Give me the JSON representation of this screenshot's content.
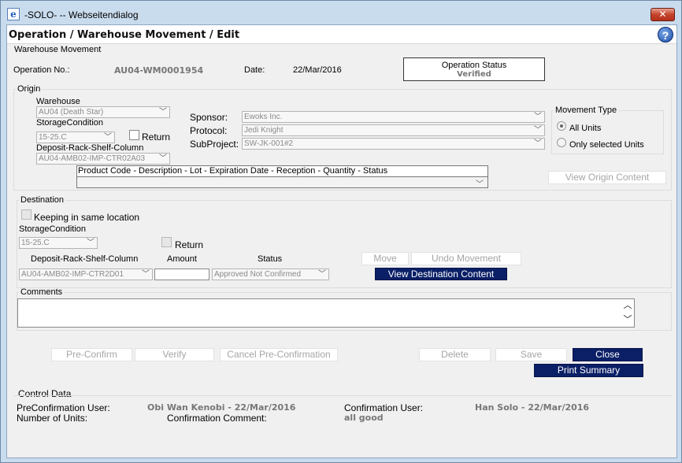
{
  "window": {
    "title": "-SOLO- -- Webseitendialog",
    "app_icon": "e",
    "close_symbol": "✕"
  },
  "header": {
    "title": "Operation / Warehouse Movement / Edit",
    "help_symbol": "?"
  },
  "section_title": "Warehouse Movement",
  "operation": {
    "no_label": "Operation No.:",
    "no_value": "AU04-WM0001954",
    "date_label": "Date:",
    "date_value": "22/Mar/2016",
    "status_label": "Operation Status",
    "status_value": "Verified"
  },
  "origin": {
    "legend": "Origin",
    "warehouse_label": "Warehouse",
    "warehouse_value": "AU04 (Death Star)",
    "storage_label": "StorageCondition",
    "storage_value": "15-25.C",
    "return_label": "Return",
    "deposit_label": "Deposit-Rack-Shelf-Column",
    "deposit_value": "AU04-AMB02-IMP-CTR02A03",
    "sponsor_label": "Sponsor:",
    "sponsor_value": "Ewoks Inc.",
    "protocol_label": "Protocol:",
    "protocol_value": "Jedi Knight",
    "subproject_label": "SubProject:",
    "subproject_value": "SW-JK-001#2",
    "movement_type_legend": "Movement Type",
    "all_units_label": "All Units",
    "selected_units_label": "Only selected Units",
    "product_header": "Product Code - Description - Lot - Expiration Date - Reception - Quantity - Status",
    "view_origin_label": "View Origin Content"
  },
  "destination": {
    "legend": "Destination",
    "keeping_label": "Keeping in same location",
    "storage_label": "StorageCondition",
    "storage_value": "15-25.C",
    "return_label": "Return",
    "deposit_label": "Deposit-Rack-Shelf-Column",
    "deposit_value": "AU04-AMB02-IMP-CTR2D01",
    "amount_label": "Amount",
    "amount_value": "",
    "status_label": "Status",
    "status_value": "Approved Not Confirmed",
    "move_label": "Move",
    "undo_label": "Undo Movement",
    "view_dest_label": "View Destination Content"
  },
  "comments": {
    "legend": "Comments",
    "value": ""
  },
  "actions": {
    "pre_confirm": "Pre-Confirm",
    "verify": "Verify",
    "cancel_pre": "Cancel Pre-Confirmation",
    "delete": "Delete",
    "save": "Save",
    "close": "Close",
    "print_summary": "Print Summary"
  },
  "control": {
    "legend": "Control Data",
    "preconf_label": "PreConfirmation User:",
    "preconf_value": "Obi Wan Kenobi - 22/Mar/2016",
    "units_label": "Number of Units:",
    "conf_comment_label": "Confirmation Comment:",
    "conf_comment_value": "all good",
    "conf_user_label": "Confirmation User:",
    "conf_user_value": "Han Solo - 22/Mar/2016"
  },
  "colors": {
    "accent_dark_button": "#0a1f66",
    "dialog_frame": "#c9dcee"
  }
}
